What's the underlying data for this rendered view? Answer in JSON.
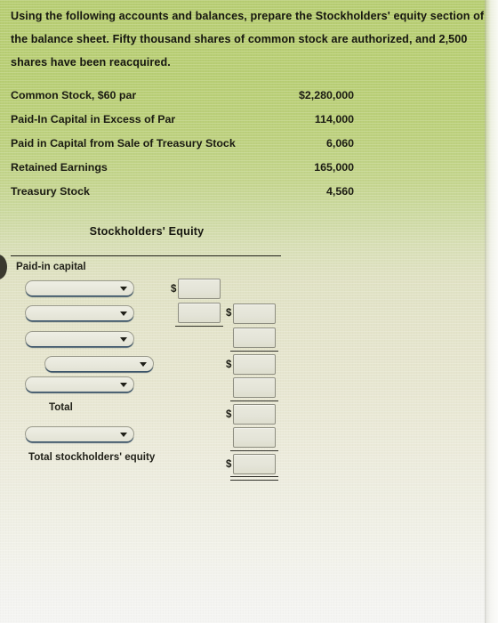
{
  "prompt": {
    "text": "Using the following accounts and balances, prepare the Stockholders' equity section of the balance sheet. Fifty thousand shares of common stock are authorized, and 2,500 shares have been reacquired."
  },
  "accounts": {
    "rows": [
      {
        "name": "Common Stock, $60 par",
        "value": "$2,280,000"
      },
      {
        "name": "Paid-In Capital in Excess of Par",
        "value": "114,000"
      },
      {
        "name": "Paid in Capital from Sale of Treasury Stock",
        "value": "6,060"
      },
      {
        "name": "Retained Earnings",
        "value": "165,000"
      },
      {
        "name": "Treasury Stock",
        "value": "4,560"
      }
    ]
  },
  "statement": {
    "title": "Stockholders' Equity",
    "label_paid_in_capital": "Paid-in capital",
    "label_total": "Total",
    "label_total_stockholders_equity": "Total stockholders' equity",
    "dropdowns": [
      {
        "value": "",
        "placeholder": ""
      },
      {
        "value": "",
        "placeholder": ""
      },
      {
        "value": "",
        "placeholder": ""
      },
      {
        "value": "",
        "placeholder": ""
      },
      {
        "value": "",
        "placeholder": ""
      },
      {
        "value": "",
        "placeholder": ""
      }
    ],
    "amount_fields": [
      {
        "value": "",
        "currency": "$"
      },
      {
        "value": "",
        "currency": ""
      },
      {
        "value": "",
        "currency": "$"
      },
      {
        "value": "",
        "currency": ""
      },
      {
        "value": "",
        "currency": "$"
      },
      {
        "value": "",
        "currency": ""
      },
      {
        "value": "",
        "currency": "$"
      },
      {
        "value": "",
        "currency": ""
      },
      {
        "value": "",
        "currency": "$"
      }
    ],
    "currency_symbol": "$"
  },
  "colors": {
    "paper_top": "#b7cd72",
    "paper_bottom": "#f4f4f2",
    "ink": "#16160f",
    "rule": "#1d1d16",
    "select_underline": "#2f4a63"
  }
}
